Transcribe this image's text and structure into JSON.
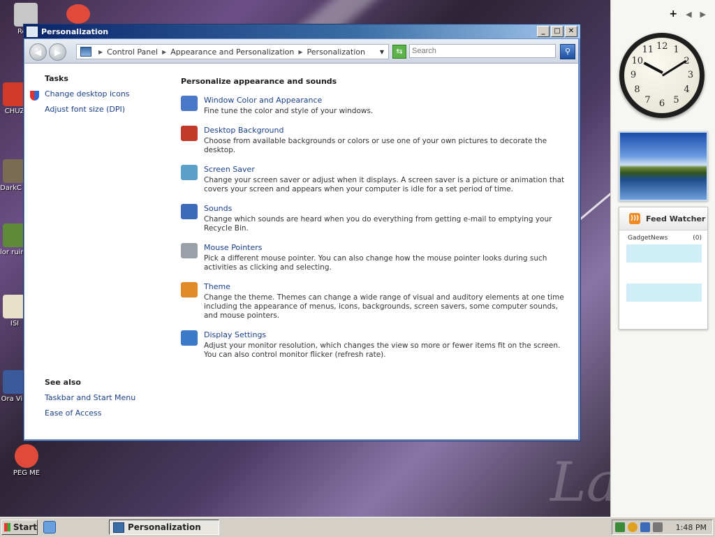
{
  "desktop": {
    "icons": [
      {
        "label": "Recy",
        "color": "#c7c7c7"
      },
      {
        "label": "CHUZ",
        "color": "#d23a2a"
      },
      {
        "label": "DarkC G",
        "color": "#7a6b52"
      },
      {
        "label": "Elor ruined",
        "color": "#5f8a3a"
      },
      {
        "label": "ISI",
        "color": "#e8e0c8"
      },
      {
        "label": "Ora Virt",
        "color": "#3a5a9a"
      },
      {
        "label": "PEG ME",
        "color": "#e04a3a"
      }
    ],
    "watermark": "La"
  },
  "sidebar": {
    "add_symbol": "+",
    "prev_symbol": "◀",
    "next_symbol": "▶",
    "clock": {
      "numbers": [
        "12",
        "1",
        "2",
        "3",
        "4",
        "5",
        "6",
        "7",
        "8",
        "9",
        "10",
        "11"
      ]
    },
    "feed": {
      "title": "Feed Watcher",
      "source": "GadgetNews",
      "count": "(0)"
    }
  },
  "window": {
    "title": "Personalization",
    "controls": {
      "minimize": "_",
      "maximize": "□",
      "close": "✕"
    },
    "breadcrumb": [
      "Control Panel",
      "Appearance and Personalization",
      "Personalization"
    ],
    "search_placeholder": "Search",
    "tasks": {
      "heading": "Tasks",
      "links": [
        "Change desktop icons",
        "Adjust font size (DPI)"
      ]
    },
    "see_also": {
      "heading": "See also",
      "links": [
        "Taskbar and Start Menu",
        "Ease of Access"
      ]
    },
    "main": {
      "heading": "Personalize appearance and sounds",
      "items": [
        {
          "title": "Window Color and Appearance",
          "desc": "Fine tune the color and style of your windows.",
          "icon": "window-color-icon",
          "color": "#4a78c8"
        },
        {
          "title": "Desktop Background",
          "desc": "Choose from available backgrounds or colors or use one of your own pictures to decorate the desktop.",
          "icon": "desktop-background-icon",
          "color": "#c23b2a"
        },
        {
          "title": "Screen Saver",
          "desc": "Change your screen saver or adjust when it displays. A screen saver is a picture or animation that covers your screen and appears when your computer is idle for a set period of time.",
          "icon": "screen-saver-icon",
          "color": "#5aa0c8"
        },
        {
          "title": "Sounds",
          "desc": "Change which sounds are heard when you do everything from getting e-mail to emptying your Recycle Bin.",
          "icon": "sounds-icon",
          "color": "#3a6ab8"
        },
        {
          "title": "Mouse Pointers",
          "desc": "Pick a different mouse pointer. You can also change how the mouse pointer looks during such activities as clicking and selecting.",
          "icon": "mouse-pointer-icon",
          "color": "#9aa0a8"
        },
        {
          "title": "Theme",
          "desc": "Change the theme. Themes can change a wide range of visual and auditory elements at one time including the appearance of menus, icons, backgrounds, screen savers, some computer sounds, and mouse pointers.",
          "icon": "theme-icon",
          "color": "#e08a2a"
        },
        {
          "title": "Display Settings",
          "desc": "Adjust your monitor resolution, which changes the view so more or fewer items fit on the screen. You can also control monitor flicker (refresh rate).",
          "icon": "display-settings-icon",
          "color": "#3a7ac8"
        }
      ]
    }
  },
  "taskbar": {
    "start_label": "Start",
    "active_task": "Personalization",
    "time": "1:48 PM"
  }
}
